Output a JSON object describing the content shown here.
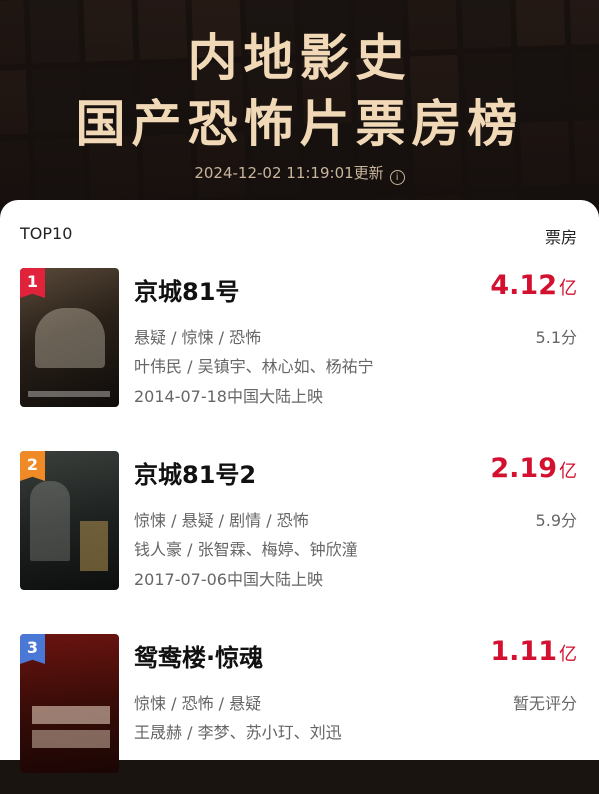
{
  "header": {
    "title_line1": "内地影史",
    "title_line2": "国产恐怖片票房榜",
    "timestamp": "2024-12-02 11:19:01更新",
    "info_icon": "info-circle-icon"
  },
  "list": {
    "left_label": "TOP10",
    "right_label": "票房",
    "items": [
      {
        "rank": "1",
        "rank_color": "#e0223a",
        "title": "京城81号",
        "box_value": "4.12",
        "box_unit": "亿",
        "genres": "悬疑 / 惊悚 / 恐怖",
        "score": "5.1分",
        "cast": "叶伟民 / 吴镇宇、林心如、杨祐宁",
        "release": "2014-07-18中国大陆上映"
      },
      {
        "rank": "2",
        "rank_color": "#f08a26",
        "title": "京城81号2",
        "box_value": "2.19",
        "box_unit": "亿",
        "genres": "惊悚 / 悬疑 / 剧情 / 恐怖",
        "score": "5.9分",
        "cast": "钱人豪 / 张智霖、梅婷、钟欣潼",
        "release": "2017-07-06中国大陆上映"
      },
      {
        "rank": "3",
        "rank_color": "#4a78d6",
        "title": "鸳鸯楼·惊魂",
        "box_value": "1.11",
        "box_unit": "亿",
        "genres": "惊悚 / 恐怖 / 悬疑",
        "score": "暂无评分",
        "cast": "王晟赫 / 李梦、苏小玎、刘迅",
        "release": ""
      }
    ]
  }
}
